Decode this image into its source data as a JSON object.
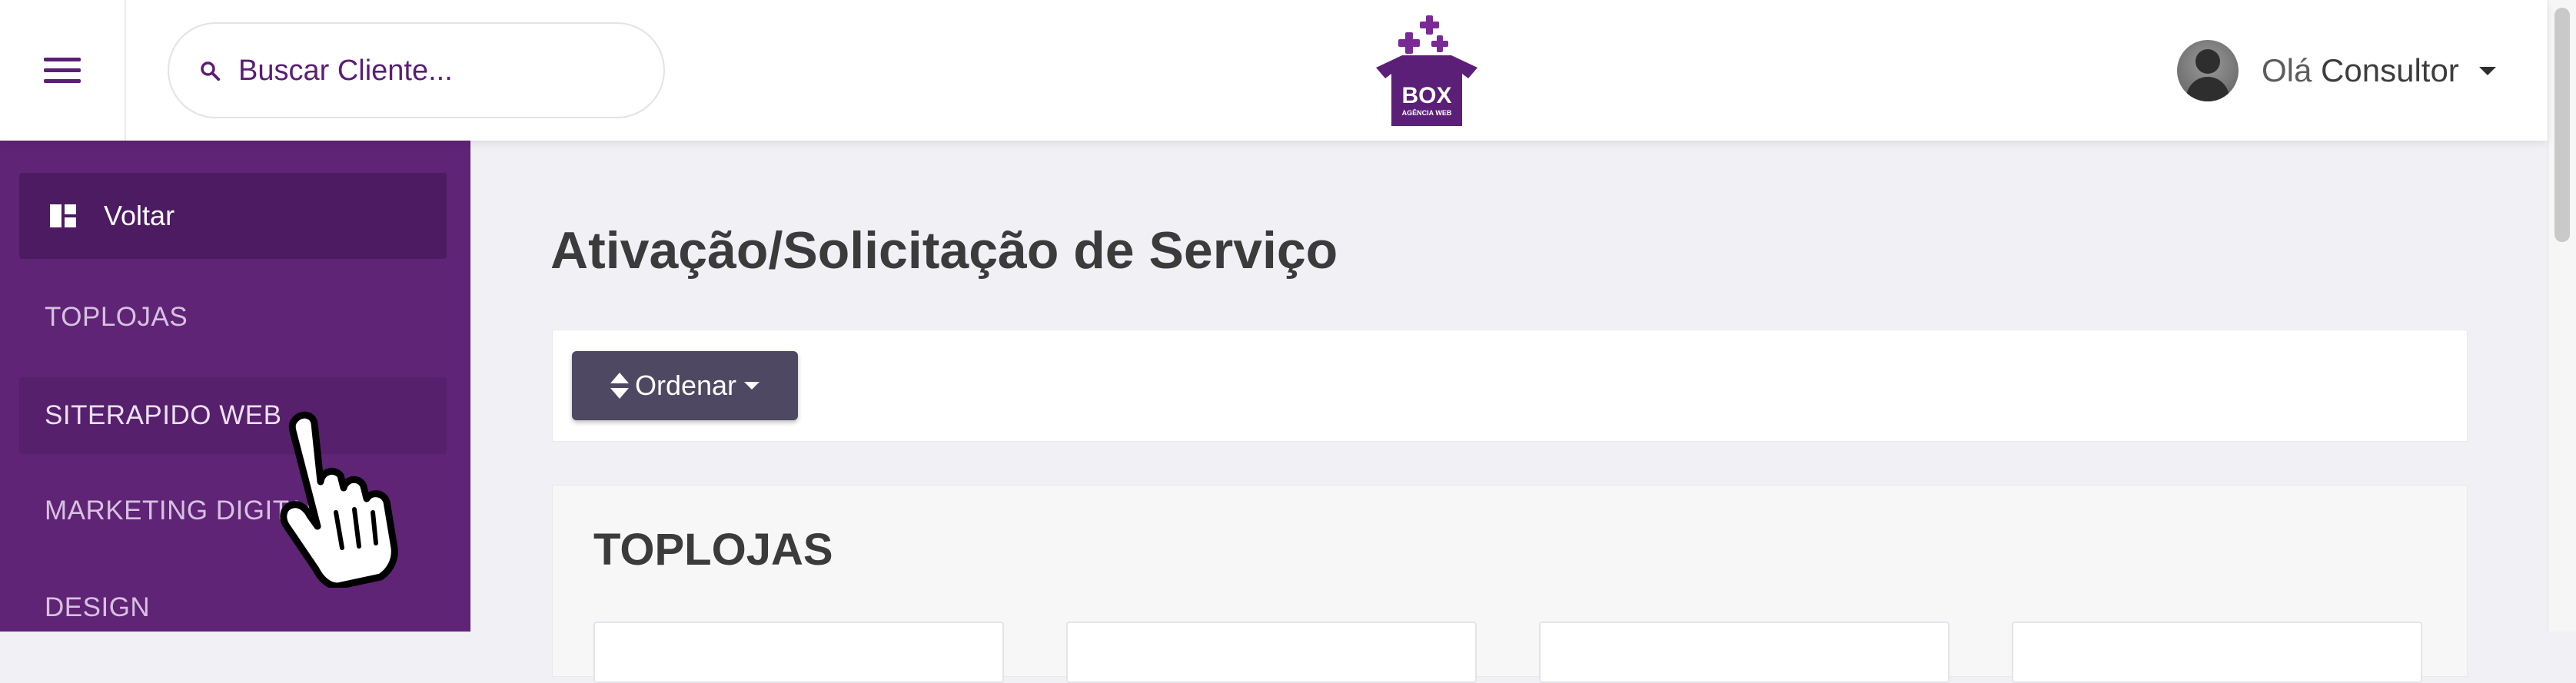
{
  "header": {
    "menu_icon": "hamburger-menu-icon",
    "search": {
      "placeholder": "Buscar Cliente...",
      "value": "",
      "icon": "search-icon"
    },
    "logo": {
      "brand": "BOX",
      "tagline": "AGÊNCIA WEB"
    },
    "user": {
      "greeting": "Olá",
      "name": "Consultor",
      "icon": "avatar"
    }
  },
  "sidebar": {
    "back": {
      "label": "Voltar",
      "icon": "dashboard-icon"
    },
    "items": [
      {
        "label": "TOPLOJAS",
        "active": false
      },
      {
        "label": "SITERAPIDO WEB",
        "active": true
      },
      {
        "label": "MARKETING DIGITAL",
        "active": false
      },
      {
        "label": "DESIGN",
        "active": false
      }
    ]
  },
  "main": {
    "title": "Ativação/Solicitação de Serviço",
    "order_button": {
      "label": "Ordenar",
      "icon": "sort-icon"
    },
    "section": {
      "title": "TOPLOJAS"
    }
  },
  "colors": {
    "sidebar": "#5f2475",
    "sidebar_dark": "#4c1b62",
    "brand_purple": "#5a1e75",
    "button": "#4e4863"
  }
}
